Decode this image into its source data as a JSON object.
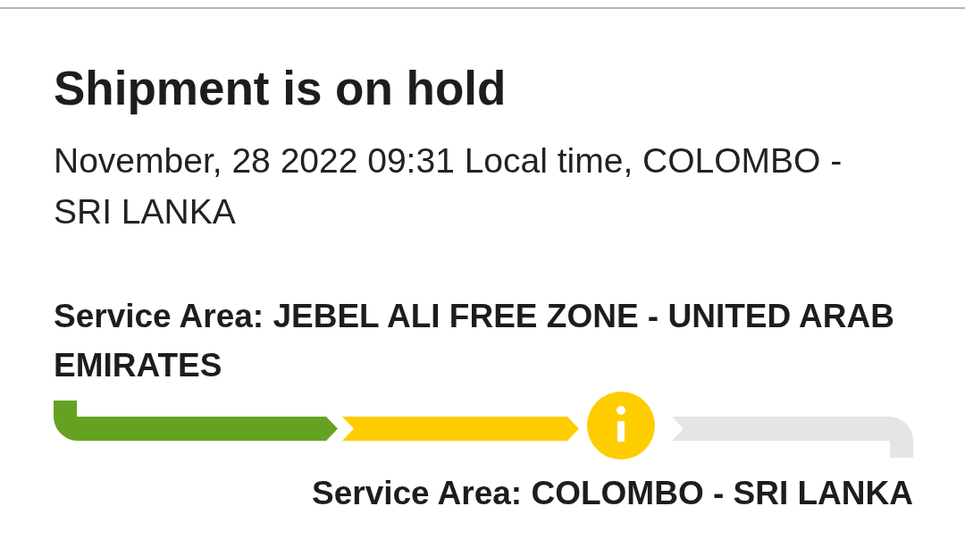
{
  "heading": "Shipment is on hold",
  "timestamp": "November, 28 2022 09:31 Local time, COLOMBO - SRI LANKA",
  "origin": "Service Area: JEBEL ALI FREE ZONE - UNITED ARAB EMIRATES",
  "progress": [
    {
      "kind": "start-bar",
      "color": "#66a221"
    },
    {
      "kind": "bar",
      "color": "#ffcc00"
    },
    {
      "kind": "info-marker",
      "color": "#ffcc00"
    },
    {
      "kind": "end-bar",
      "color": "#e5e5e5"
    }
  ],
  "destination": "Service Area: COLOMBO - SRI LANKA"
}
